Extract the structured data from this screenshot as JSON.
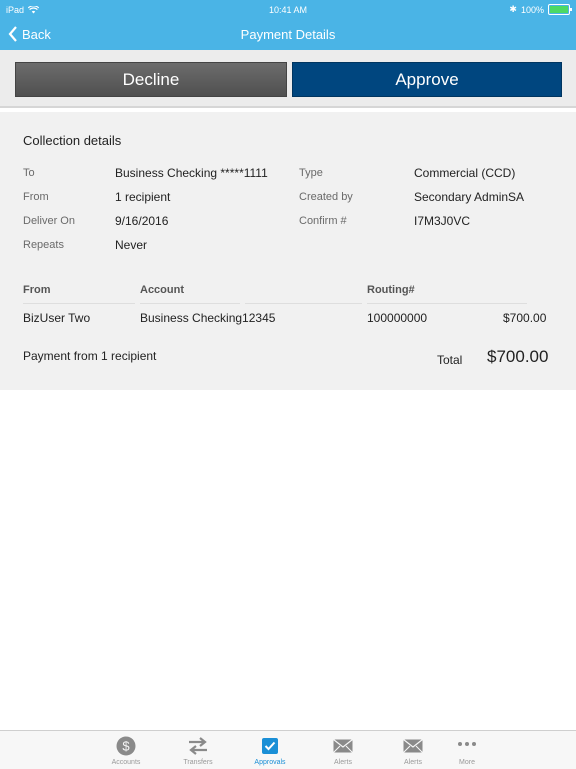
{
  "status": {
    "device": "iPad",
    "time": "10:41 AM",
    "battery": "100%"
  },
  "nav": {
    "back_label": "Back",
    "title": "Payment Details"
  },
  "actions": {
    "decline_label": "Decline",
    "approve_label": "Approve"
  },
  "details": {
    "section_title": "Collection details",
    "to_label": "To",
    "to_value": "Business Checking *****1111",
    "from_label": "From",
    "from_value": "1 recipient",
    "deliver_label": "Deliver On",
    "deliver_value": "9/16/2016",
    "repeats_label": "Repeats",
    "repeats_value": "Never",
    "type_label": "Type",
    "type_value": "Commercial (CCD)",
    "created_label": "Created by",
    "created_value": "Secondary AdminSA",
    "confirm_label": "Confirm #",
    "confirm_value": "I7M3J0VC"
  },
  "table": {
    "headers": {
      "from": "From",
      "account": "Account",
      "routing": "Routing#"
    },
    "rows": [
      {
        "from": "BizUser Two",
        "account": "Business Checking12345",
        "routing": "100000000",
        "amount": "$700.00"
      }
    ]
  },
  "summary": {
    "text": "Payment from 1 recipient",
    "total_label": "Total",
    "total_value": "$700.00"
  },
  "tabs": [
    {
      "label": "Accounts",
      "icon": "dollar-circle-icon"
    },
    {
      "label": "Transfers",
      "icon": "transfer-arrows-icon"
    },
    {
      "label": "Approvals",
      "icon": "checkbox-icon"
    },
    {
      "label": "Alerts",
      "icon": "envelope-icon"
    },
    {
      "label": "Alerts",
      "icon": "envelope-icon"
    },
    {
      "label": "More",
      "icon": "more-dots-icon"
    }
  ],
  "colors": {
    "accent": "#4ab4e6",
    "approve": "#00467f",
    "decline": "#5a5a5a",
    "active_tab": "#1a8fd6"
  }
}
